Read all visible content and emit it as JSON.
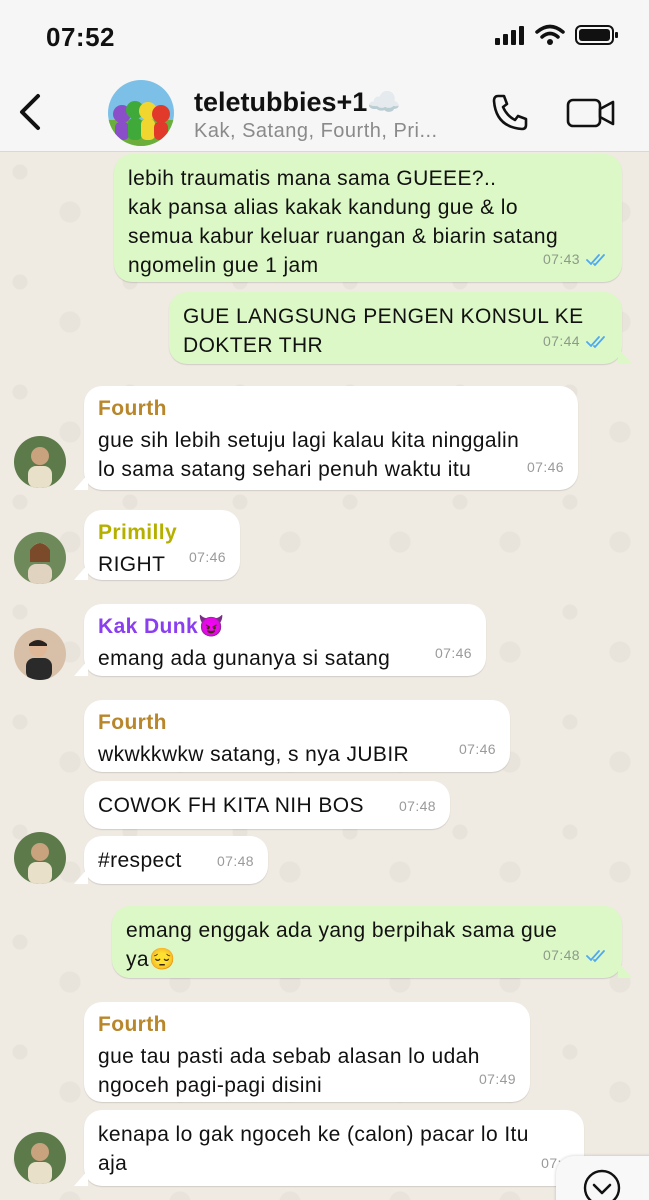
{
  "status_bar": {
    "time": "07:52"
  },
  "header": {
    "title": "teletubbies+1",
    "title_emoji": "☁️",
    "subtitle": "Kak, Satang, Fourth, Pri..."
  },
  "colors": {
    "outgoing": "#dcf8c6",
    "incoming": "#ffffff",
    "fourth": "#b8862b",
    "primilly": "#b5b000",
    "kak_dunk": "#8a3ef0",
    "read_ticks": "#4fa8f0"
  },
  "messages": [
    {
      "direction": "out",
      "lines": [
        "lebih traumatis mana sama GUEEE?..",
        "kak pansa alias kakak kandung gue & lo",
        "semua kabur keluar ruangan & biarin satang",
        "ngomelin gue 1 jam"
      ],
      "time": "07:43",
      "read": true
    },
    {
      "direction": "out",
      "lines": [
        "GUE LANGSUNG PENGEN KONSUL KE",
        "DOKTER THR"
      ],
      "time": "07:44",
      "read": true
    },
    {
      "direction": "in",
      "sender": "Fourth",
      "lines": [
        "gue sih lebih setuju lagi kalau kita ninggalin",
        "lo sama satang sehari penuh waktu itu"
      ],
      "time": "07:46"
    },
    {
      "direction": "in",
      "sender": "Primilly",
      "lines": [
        "RIGHT"
      ],
      "time": "07:46"
    },
    {
      "direction": "in",
      "sender": "Kak Dunk",
      "sender_emoji": "😈",
      "lines": [
        "emang ada gunanya si satang"
      ],
      "time": "07:46"
    },
    {
      "direction": "in",
      "sender": "Fourth",
      "lines": [
        "wkwkkwkw satang, s nya JUBIR"
      ],
      "time": "07:46"
    },
    {
      "direction": "in",
      "lines": [
        "COWOK FH KITA NIH BOS"
      ],
      "time": "07:48"
    },
    {
      "direction": "in",
      "lines": [
        "#respect"
      ],
      "time": "07:48"
    },
    {
      "direction": "out",
      "lines": [
        "emang enggak ada yang berpihak sama gue",
        "ya😔"
      ],
      "time": "07:48",
      "read": true
    },
    {
      "direction": "in",
      "sender": "Fourth",
      "lines": [
        "gue tau pasti ada sebab alasan lo udah",
        "ngoceh pagi-pagi disini"
      ],
      "time": "07:49"
    },
    {
      "direction": "in",
      "lines": [
        "kenapa lo gak ngoceh ke (calon) pacar lo Itu",
        "aja"
      ],
      "time": "07:4"
    }
  ]
}
